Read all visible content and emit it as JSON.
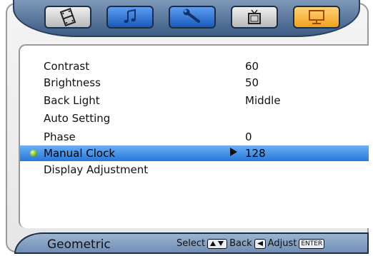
{
  "tabs": [
    {
      "icon": "film-icon",
      "state": "normal"
    },
    {
      "icon": "music-note-icon",
      "state": "normal"
    },
    {
      "icon": "wrench-icon",
      "state": "normal"
    },
    {
      "icon": "tv-icon",
      "state": "normal"
    },
    {
      "icon": "monitor-icon",
      "state": "active"
    }
  ],
  "menu": {
    "items": [
      {
        "label": "Contrast",
        "value": "60"
      },
      {
        "label": "Brightness",
        "value": "50"
      },
      {
        "label": "Back Light",
        "value": "Middle"
      },
      {
        "label": "Auto Setting",
        "value": ""
      },
      {
        "label": "Phase",
        "value": "0"
      },
      {
        "label": "Manual Clock",
        "value": "128",
        "selected": true
      },
      {
        "label": "Display Adjustment",
        "value": ""
      }
    ]
  },
  "status": {
    "title": "Geometric",
    "select_label": "Select",
    "back_label": "Back",
    "adjust_label": "Adjust",
    "enter_key": "ENTER"
  },
  "colors": {
    "selected_row": "#2677d8",
    "active_tab": "#f0a21a",
    "blue_tab": "#1a5bbd"
  }
}
